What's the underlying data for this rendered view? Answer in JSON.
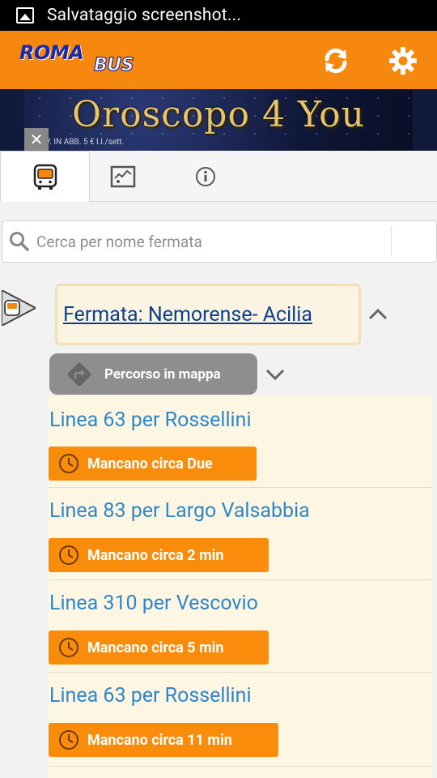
{
  "status_bar": {
    "title": "Salvataggio screenshot...",
    "icon": "image-icon"
  },
  "app_bar": {
    "logo_roma": "ROMA",
    "logo_bus": "BUS",
    "refresh_icon": "refresh-icon",
    "settings_icon": "gear-icon",
    "color": "#f7880f"
  },
  "banner": {
    "title": "Oroscopo 4 You",
    "subtitle": "V. IN ABB. 5 € I.l./sett.",
    "close": "✕"
  },
  "tabs": [
    {
      "name": "bus-stop-tab",
      "icon": "bus-icon",
      "active": true
    },
    {
      "name": "map-tab",
      "icon": "map-icon",
      "active": false
    },
    {
      "name": "info-tab",
      "icon": "info-icon",
      "active": false
    }
  ],
  "search": {
    "placeholder": "Cerca per nome fermata",
    "value": ""
  },
  "stop": {
    "title": "Fermata: Nemorense- Acilia",
    "map_button": "Percorso in mappa"
  },
  "arrivals": [
    {
      "line": "Linea 63 per Rossellini",
      "eta": "Mancano circa Due"
    },
    {
      "line": "Linea 83 per Largo Valsabbia",
      "eta": "Mancano circa 2 min"
    },
    {
      "line": "Linea 310 per Vescovio",
      "eta": "Mancano circa 5 min"
    },
    {
      "line": "Linea 63 per Rossellini",
      "eta": "Mancano circa 11 min"
    }
  ]
}
